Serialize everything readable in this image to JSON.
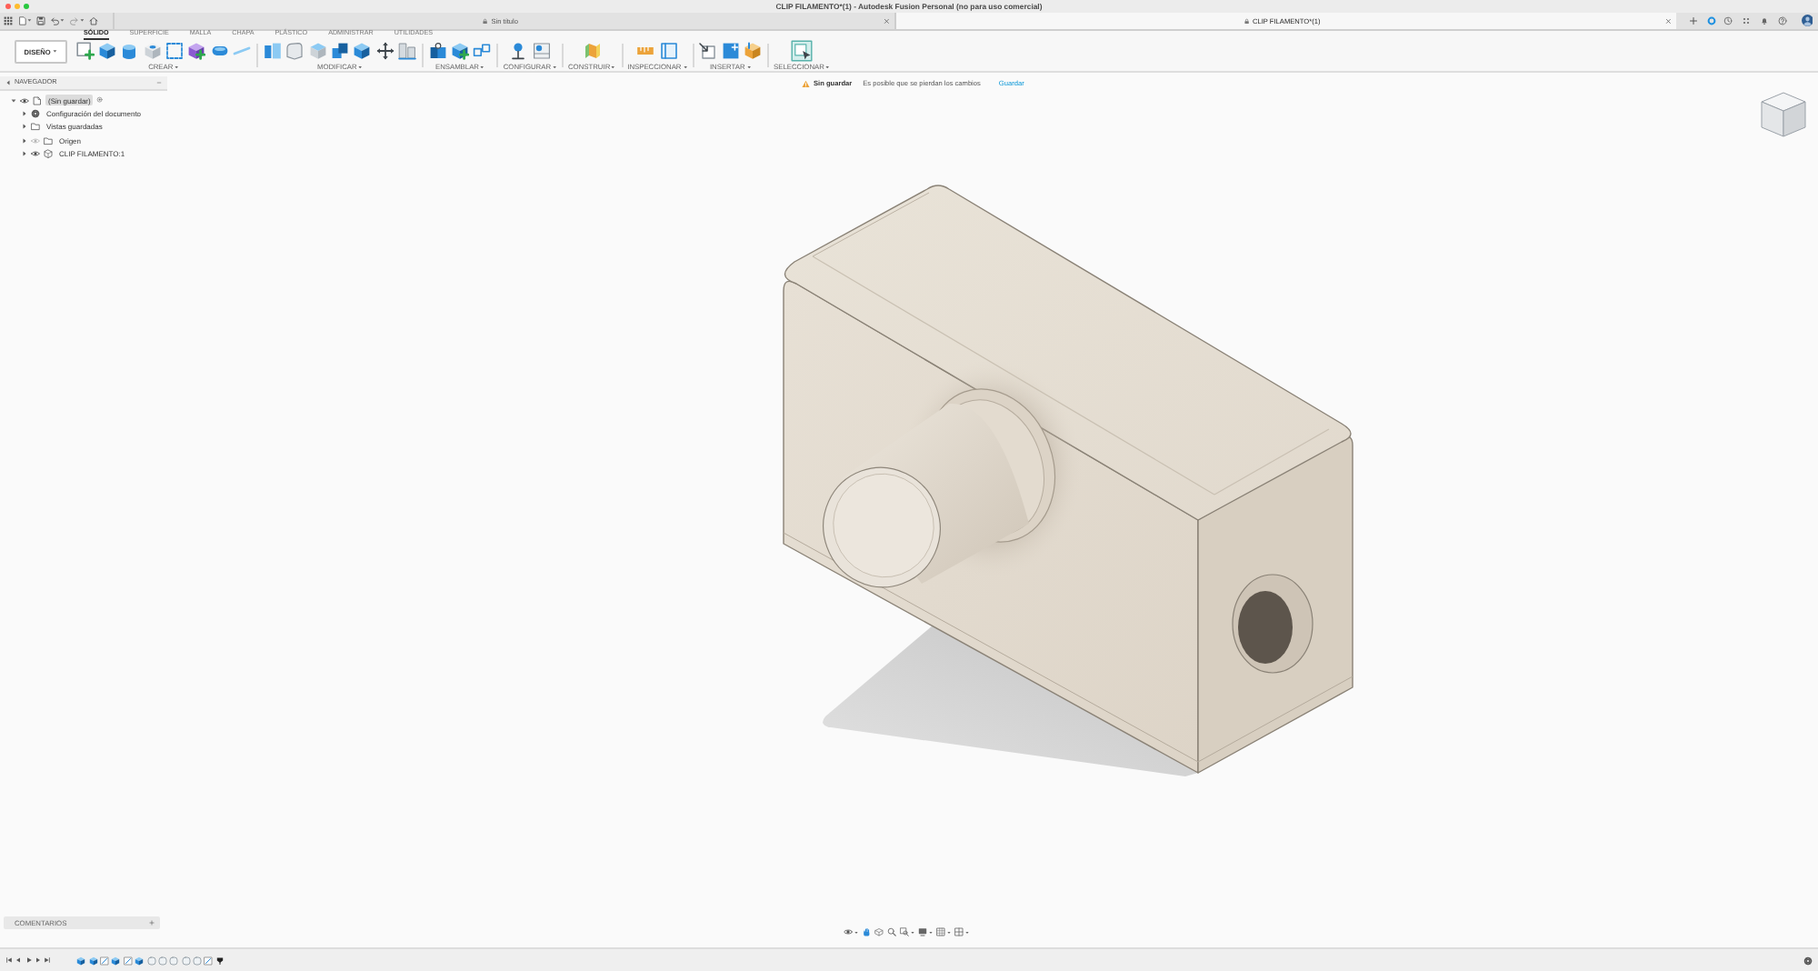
{
  "window": {
    "title": "CLIP FILAMENTO*(1) - Autodesk Fusion Personal (no para uso comercial)"
  },
  "document_tabs": [
    {
      "label": "Sin título",
      "selected": false
    },
    {
      "label": "CLIP FILAMENTO*(1)",
      "selected": true
    }
  ],
  "workspace": {
    "label": "DISEÑO"
  },
  "toolbar_tabs": [
    {
      "label": "SÓLIDO",
      "selected": true
    },
    {
      "label": "SUPERFICIE",
      "selected": false
    },
    {
      "label": "MALLA",
      "selected": false
    },
    {
      "label": "CHAPA",
      "selected": false
    },
    {
      "label": "PLÁSTICO",
      "selected": false
    },
    {
      "label": "ADMINISTRAR",
      "selected": false
    },
    {
      "label": "UTILIDADES",
      "selected": false
    }
  ],
  "tool_groups": [
    {
      "label": "CREAR"
    },
    {
      "label": "MODIFICAR"
    },
    {
      "label": "ENSAMBLAR"
    },
    {
      "label": "CONFIGURAR"
    },
    {
      "label": "CONSTRUIR"
    },
    {
      "label": "INSPECCIONAR"
    },
    {
      "label": "INSERTAR"
    },
    {
      "label": "SELECCIONAR"
    }
  ],
  "browser": {
    "title": "NAVEGADOR",
    "root": {
      "label": "(Sin guardar)",
      "expanded": true,
      "visible": true,
      "active": true,
      "children": [
        {
          "label": "Configuración del documento",
          "kind": "settings",
          "expanded": false
        },
        {
          "label": "Vistas guardadas",
          "kind": "folder",
          "expanded": false
        },
        {
          "label": "Origen",
          "kind": "folder",
          "expanded": false,
          "visible": false
        },
        {
          "label": "CLIP FILAMENTO:1",
          "kind": "component",
          "expanded": false,
          "visible": true
        }
      ]
    }
  },
  "notice": {
    "title": "Sin guardar",
    "message": "Es posible que se pierdan los cambios",
    "action": "Guardar"
  },
  "comments": {
    "title": "COMENTARIOS"
  }
}
